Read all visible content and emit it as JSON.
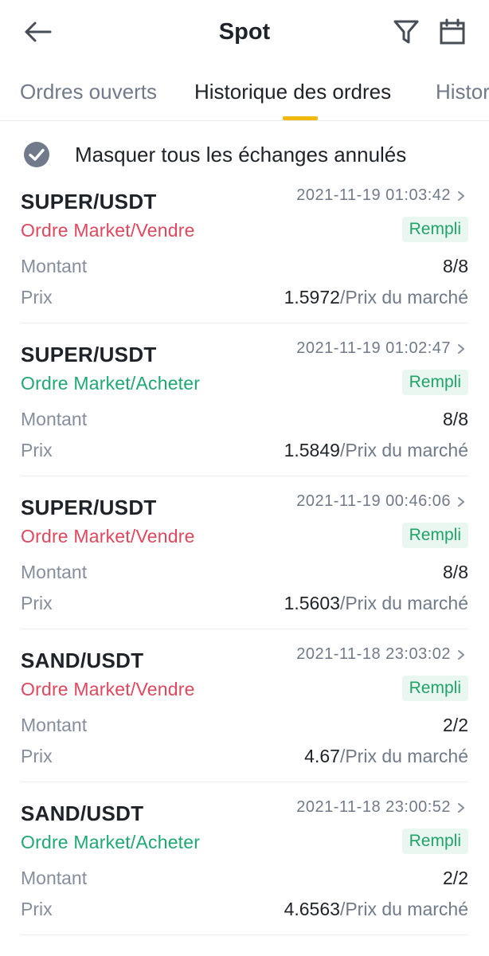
{
  "header": {
    "title": "Spot",
    "back_icon": "arrow-left-icon",
    "filter_icon": "filter-icon",
    "calendar_icon": "calendar-icon"
  },
  "tabs": [
    {
      "label": "Ordres ouverts",
      "active": false
    },
    {
      "label": "Historique des ordres",
      "active": true
    },
    {
      "label": "Historique des trades",
      "active": false
    }
  ],
  "hide_cancelled": {
    "label": "Masquer tous les échanges annulés",
    "checked": true
  },
  "labels": {
    "amount": "Montant",
    "price": "Prix",
    "price_suffix": "/Prix du marché"
  },
  "orders": [
    {
      "pair": "SUPER/USDT",
      "time": "2021-11-19 01:03:42",
      "type": "Ordre Market/Vendre",
      "side": "sell",
      "status": "Rempli",
      "amount": "8/8",
      "price": "1.5972"
    },
    {
      "pair": "SUPER/USDT",
      "time": "2021-11-19 01:02:47",
      "type": "Ordre Market/Acheter",
      "side": "buy",
      "status": "Rempli",
      "amount": "8/8",
      "price": "1.5849"
    },
    {
      "pair": "SUPER/USDT",
      "time": "2021-11-19 00:46:06",
      "type": "Ordre Market/Vendre",
      "side": "sell",
      "status": "Rempli",
      "amount": "8/8",
      "price": "1.5603"
    },
    {
      "pair": "SAND/USDT",
      "time": "2021-11-18 23:03:02",
      "type": "Ordre Market/Vendre",
      "side": "sell",
      "status": "Rempli",
      "amount": "2/2",
      "price": "4.67"
    },
    {
      "pair": "SAND/USDT",
      "time": "2021-11-18 23:00:52",
      "type": "Ordre Market/Acheter",
      "side": "buy",
      "status": "Rempli",
      "amount": "2/2",
      "price": "4.6563"
    }
  ],
  "colors": {
    "sell": "#e0475d",
    "buy": "#1fa871",
    "accent": "#f0b90b",
    "filled_badge": "#21a36a"
  }
}
